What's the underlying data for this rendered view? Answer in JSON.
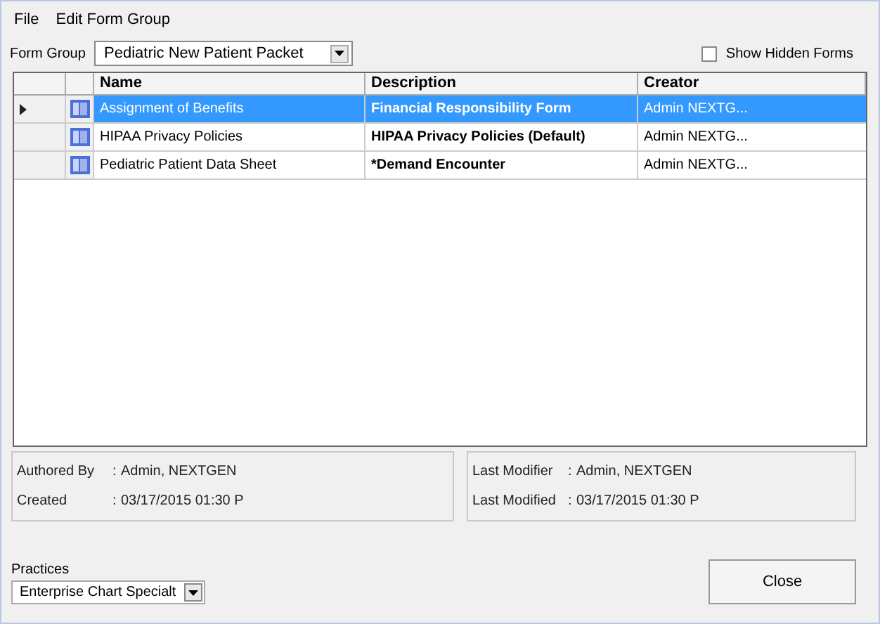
{
  "menu": [
    "File",
    "Edit Form Group"
  ],
  "form_group": {
    "label": "Form Group",
    "value": "Pediatric New Patient Packet"
  },
  "show_hidden_forms": {
    "label": "Show Hidden Forms",
    "checked": false
  },
  "table": {
    "columns": [
      "Name",
      "Description",
      "Creator"
    ],
    "rows": [
      {
        "name": "Assignment of Benefits",
        "description": "Financial Responsibility Form",
        "creator": "Admin NEXTG...",
        "selected": true
      },
      {
        "name": "HIPAA Privacy Policies",
        "description": "HIPAA Privacy Policies (Default)",
        "creator": "Admin NEXTG...",
        "selected": false
      },
      {
        "name": "Pediatric Patient Data Sheet",
        "description": "*Demand Encounter",
        "creator": "Admin NEXTG...",
        "selected": false
      }
    ]
  },
  "authored": [
    {
      "label": "Authored By",
      "separator": ":",
      "value": "Admin, NEXTGEN"
    },
    {
      "label": "Created",
      "separator": ":",
      "value": "03/17/2015 01:30 P"
    }
  ],
  "modified": [
    {
      "label": "Last Modifier",
      "separator": ":",
      "value": "Admin, NEXTGEN"
    },
    {
      "label": "Last Modified",
      "separator": ":",
      "value": "03/17/2015 01:30 P"
    }
  ],
  "practices": {
    "label": "Practices",
    "value": "Enterprise Chart Specialt"
  },
  "close_button": "Close"
}
